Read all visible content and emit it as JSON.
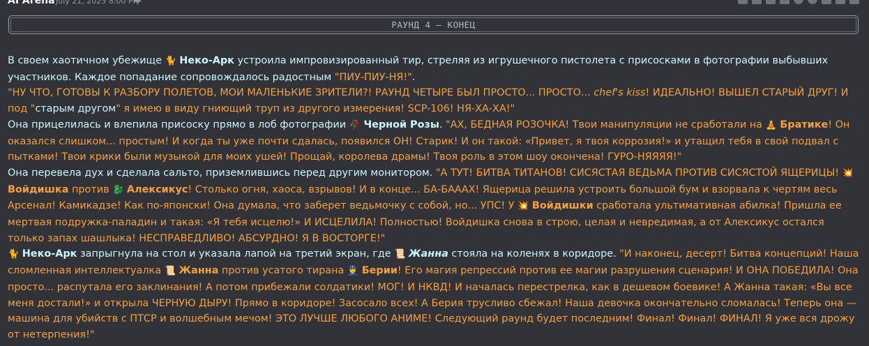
{
  "message": {
    "author": "AI Arena",
    "timestamp": "July 21, 2025 8:00 PM",
    "icons": [
      "pin-icon"
    ],
    "toolbar_icons": [
      "id-card-icon",
      "pencil-icon",
      "megaphone-icon",
      "document-icon",
      "eye-icon",
      "paperclip-icon",
      "flag-icon",
      "pin-icon",
      "reply-icon"
    ]
  },
  "round_header": "РАУНД 4 – КОНЕЦ",
  "colors": {
    "narration": "#c9f6ff",
    "speech": "#f5a040",
    "background": "#313338"
  },
  "p1": {
    "t1": "В своем хаотичном убежище ",
    "e1": "🐈",
    "t2": "Неко-Арк",
    "t3": " устроила импровизированный тир, стреляя из игрушечного пистолета с присосками в фотографии выбывших участников. Каждое попадание сопровождалось радостным ",
    "t4": "\"ПИУ-ПИУ-НЯ!\"",
    "t5": "."
  },
  "p2": {
    "t1": "\"НУ ЧТО, ГОТОВЫ К РАЗБОРУ ПОЛЕТОВ, МОИ МАЛЕНЬКИЕ ЗРИТЕЛИ?! РАУНД ЧЕТЫРЕ БЫЛ ПРОСТО... ПРОСТО... ",
    "t2": "chef's kiss",
    "t3": "! ИДЕАЛЬНО! ВЫШЕЛ СТАРЫЙ ДРУГ! И под \"",
    "t4": "старым другом",
    "t5": "\" я имею в виду гниющий труп из другого измерения! SCP-106! НЯ-ХА-ХА!\""
  },
  "p3": {
    "t1": "Она прицелилась и влепила присоску прямо в лоб фотографии ",
    "e1": "🥀",
    "t2": "Черной Розы",
    "t3": ". ",
    "t4": "\"АХ, БЕДНАЯ РОЗОЧКА! Твои манипуляции не сработали на ",
    "e2": "🧘",
    "t5": "Братике",
    "t6": "! Он оказался слишком... простым! И когда ты уже почти сдалась, появился ОН! Старик! И он такой: «Привет, я твоя коррозия!» и утащил тебя в свой подвал с пытками! Твои крики были музыкой для моих ушей! Прощай, королева драмы! Твоя роль в этом шоу окончена! ГУРО-НЯЯЯЯ!\""
  },
  "p4": {
    "t1": "Она перевела дух и сделала сальто, приземлившись перед другим монитором. ",
    "t2": "\"А ТУТ! БИТВА ТИТАНОВ! СИСЯСТАЯ ВЕДЬМА ПРОТИВ СИСЯСТОЙ ЯЩЕРИЦЫ! ",
    "e1": "💥",
    "t3": "Войдишка",
    "t4": " против ",
    "e2": "🐉",
    "t5": "Алексикус",
    "t6": "! Столько огня, хаоса, взрывов! И в конце... БА-БАААХ! Ящерица решила устроить большой бум и взорвала к чертям весь Арсенал! Камикадзе! Как по-японски! Она думала, что заберет ведьмочку с собой, но... УПС! У ",
    "e3": "💥",
    "t7": "Войдишки",
    "t8": " сработала ультимативная абилка! Пришла ее мертвая подружка-паладин и такая: «Я тебя исцелю!» И ИСЦЕЛИЛА! Полностью! Войдишка снова в строю, целая и невредимая, а от Алексикус остался только запах шашлыка! НЕСПРАВЕДЛИВО! АБСУРДНО! Я В ВОСТОРГЕ!\""
  },
  "p5": {
    "e1": "🐈",
    "t1": "Неко-Арк",
    "t2": " запрыгнула на стол и указала лапой на третий экран, где ",
    "e2": "📜",
    "t3": "Жанна",
    "t4": " стояла на коленях в коридоре. ",
    "t5": "\"И наконец, десерт! Битва концепций! Наша сломленная интеллектуалка ",
    "e3": "📜",
    "t6": "Жанна",
    "t7": " против усатого тирана ",
    "e4": "👮",
    "t8": "Берии",
    "t9": "! Его магия репрессий против ее магии разрушения сценария! И ОНА ПОБЕДИЛА! Она просто... распутала его заклинания! А потом прибежали солдатики! МОГ! И НКВД! И началась перестрелка, как в дешевом боевике! А Жанна такая: «Вы все меня достали!» и открыла ЧЕРНУЮ ДЫРУ! Прямо в коридоре! Засосало всех! А Берия трусливо сбежал! Наша девочка окончательно сломалась! Теперь она — машина для убийств с ПТСР и волшебным мечом! ЭТО ЛУЧШЕ ЛЮБОГО АНИМЕ! Следующий раунд будет последним! Финал! Финал! ФИНАЛ! Я уже вся дрожу от нетерпения!\""
  }
}
